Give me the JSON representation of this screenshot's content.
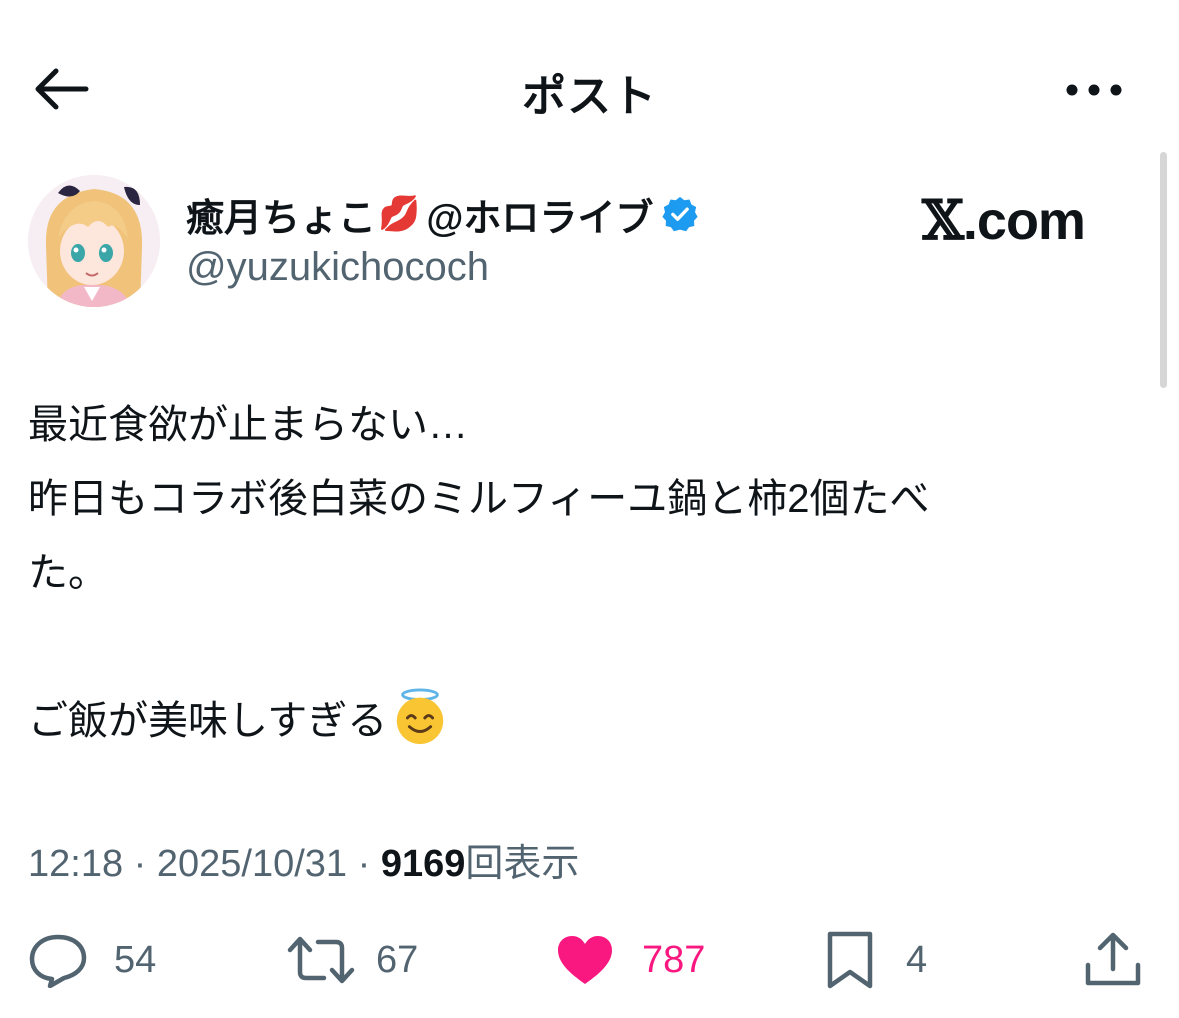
{
  "header": {
    "title": "ポスト",
    "back_icon": "arrow-left-icon",
    "more_icon": "more-horizontal-icon"
  },
  "author": {
    "display_name": "癒月ちょこ",
    "emoji": "💋",
    "affiliation": "@ホロライブ",
    "handle": "@yuzukichococh",
    "verified": true,
    "verified_color": "#1d9bf0"
  },
  "watermark": {
    "x": "𝕏",
    "domain": ".com"
  },
  "post": {
    "lines": [
      "最近食欲が止まらない…",
      "昨日もコラボ後白菜のミルフィーユ鍋と柿2個たべ",
      "た。",
      "",
      "ご飯が美味しすぎる"
    ],
    "trailing_emoji": "smiling-face-with-halo-icon"
  },
  "meta": {
    "time": "12:18",
    "separator": "·",
    "date": "2025/10/31",
    "views": "9169",
    "views_label": "回表示"
  },
  "actions": {
    "replies": "54",
    "reposts": "67",
    "likes": "787",
    "bookmarks": "4",
    "like_color": "#f91880",
    "icon_color": "#536471"
  }
}
